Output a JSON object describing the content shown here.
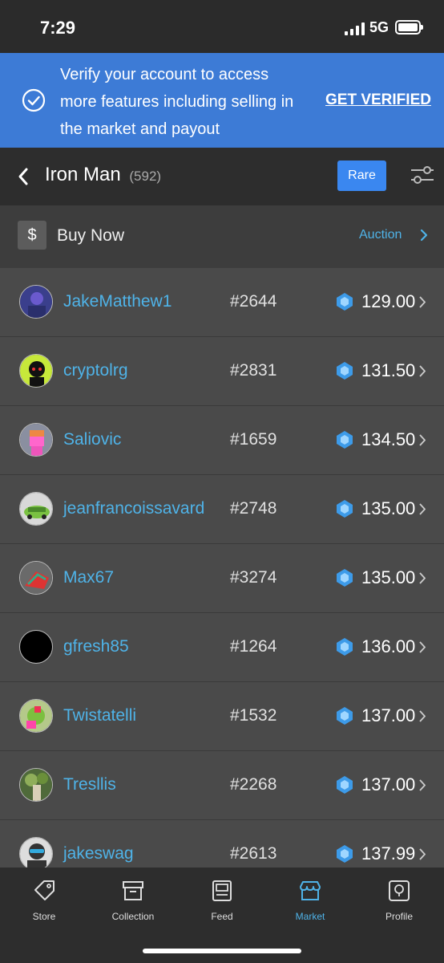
{
  "status_bar": {
    "time": "7:29",
    "network": "5G"
  },
  "banner": {
    "text": "Verify your account to access more features including selling in the market and payout",
    "cta": "GET VERIFIED",
    "icon": "check-circle-icon"
  },
  "header": {
    "title": "Iron Man",
    "count": "(592)",
    "rare_label": "Rare"
  },
  "buy_now": {
    "label": "Buy Now",
    "dollar": "$",
    "auction_label": "Auction"
  },
  "accent_color": "#4fb3e8",
  "listings": [
    {
      "username": "JakeMatthew1",
      "serial": "#2644",
      "price": "129.00"
    },
    {
      "username": "cryptolrg",
      "serial": "#2831",
      "price": "131.50"
    },
    {
      "username": "Saliovic",
      "serial": "#1659",
      "price": "134.50"
    },
    {
      "username": "jeanfrancoissavard",
      "serial": "#2748",
      "price": "135.00"
    },
    {
      "username": "Max67",
      "serial": "#3274",
      "price": "135.00"
    },
    {
      "username": "gfresh85",
      "serial": "#1264",
      "price": "136.00"
    },
    {
      "username": "Twistatelli",
      "serial": "#1532",
      "price": "137.00"
    },
    {
      "username": "Tresllis",
      "serial": "#2268",
      "price": "137.00"
    },
    {
      "username": "jakeswag",
      "serial": "#2613",
      "price": "137.99"
    }
  ],
  "tabs": [
    {
      "label": "Store",
      "icon": "store-tag-icon"
    },
    {
      "label": "Collection",
      "icon": "collection-box-icon"
    },
    {
      "label": "Feed",
      "icon": "feed-icon"
    },
    {
      "label": "Market",
      "icon": "market-icon",
      "active": true
    },
    {
      "label": "Profile",
      "icon": "profile-icon"
    }
  ]
}
